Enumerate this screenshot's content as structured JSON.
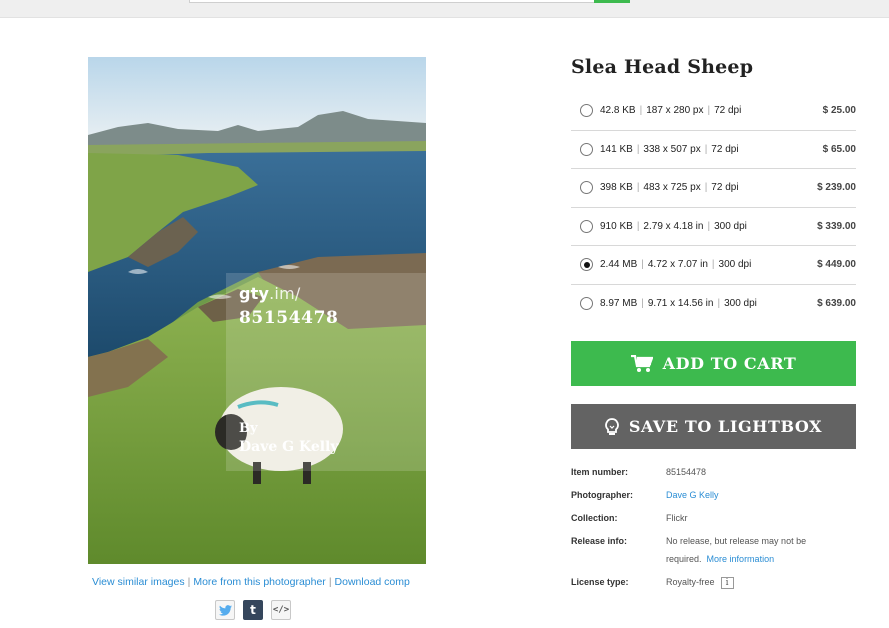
{
  "photo": {
    "watermark_site": "gty",
    "watermark_path": ".im/",
    "watermark_id": "85154478",
    "watermark_by": "By",
    "watermark_author": "Dave G Kelly"
  },
  "photo_links": {
    "similar": "View similar images",
    "more": "More from this photographer",
    "download": "Download comp"
  },
  "share": {
    "twitter_icon": "twitter-icon",
    "tumblr_glyph": "t",
    "embed_glyph": "</>"
  },
  "title": "Slea Head Sheep",
  "sizes": [
    {
      "file": "42.8 KB",
      "dims": "187 x 280 px",
      "res": "72 dpi",
      "price": "$ 25.00",
      "selected": false
    },
    {
      "file": "141 KB",
      "dims": "338 x 507 px",
      "res": "72 dpi",
      "price": "$ 65.00",
      "selected": false
    },
    {
      "file": "398 KB",
      "dims": "483 x 725 px",
      "res": "72 dpi",
      "price": "$ 239.00",
      "selected": false
    },
    {
      "file": "910 KB",
      "dims": "2.79 x 4.18 in",
      "res": "300 dpi",
      "price": "$ 339.00",
      "selected": false
    },
    {
      "file": "2.44 MB",
      "dims": "4.72 x 7.07 in",
      "res": "300 dpi",
      "price": "$ 449.00",
      "selected": true
    },
    {
      "file": "8.97 MB",
      "dims": "9.71 x 14.56 in",
      "res": "300 dpi",
      "price": "$ 639.00",
      "selected": false
    }
  ],
  "buttons": {
    "add_to_cart": "ADD TO CART",
    "save_to_lightbox": "SAVE TO LIGHTBOX"
  },
  "details": {
    "item_number_label": "Item number:",
    "item_number": "85154478",
    "photographer_label": "Photographer:",
    "photographer": "Dave G Kelly",
    "collection_label": "Collection:",
    "collection": "Flickr",
    "release_label": "Release info:",
    "release_text": "No release, but release may not be required.",
    "release_link": "More information",
    "license_label": "License type:",
    "license": "Royalty-free",
    "license_info_glyph": "i"
  },
  "colors": {
    "accent_green": "#3dba4e",
    "button_gray": "#636363",
    "link_blue": "#2a8dd4"
  }
}
